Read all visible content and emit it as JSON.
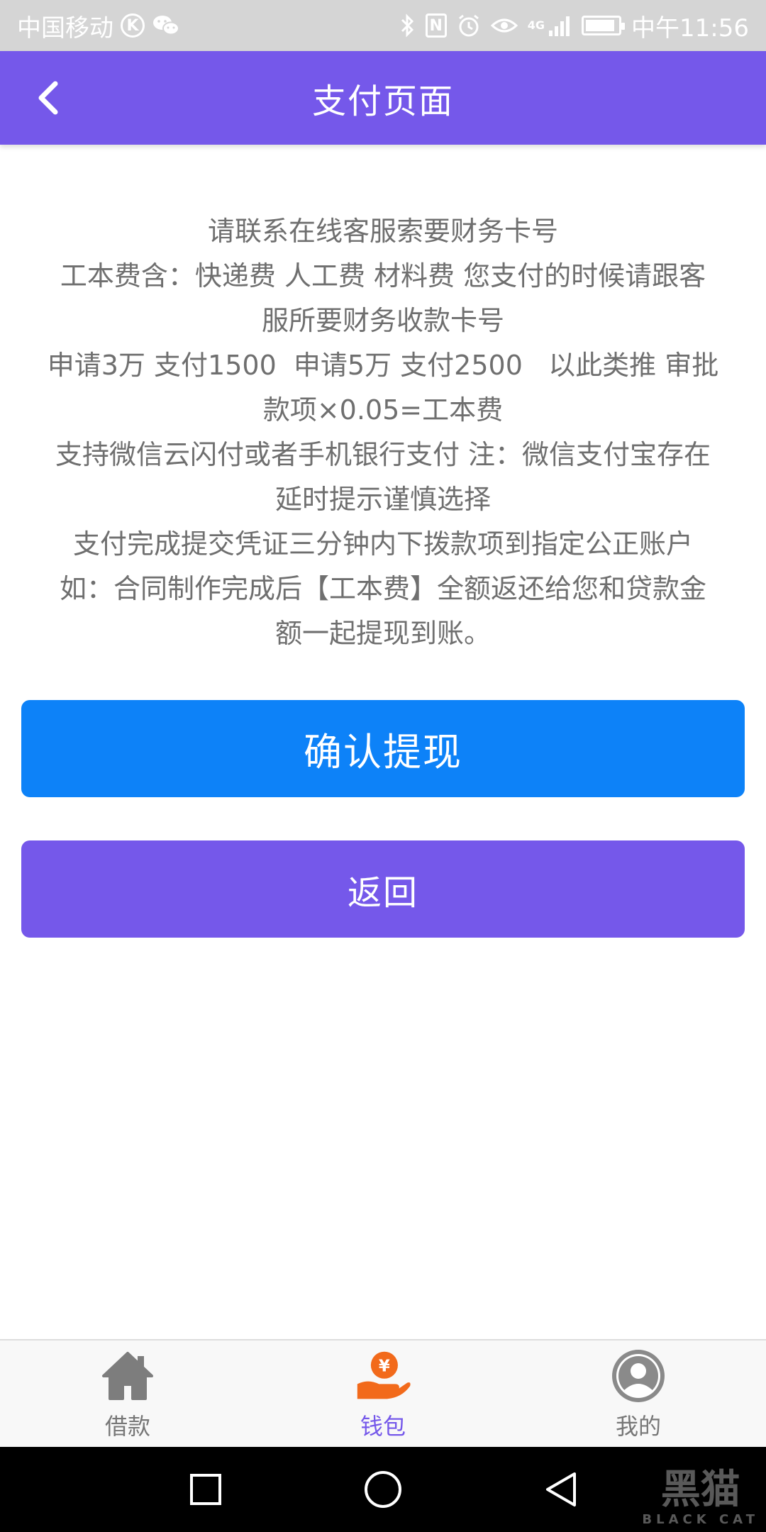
{
  "status_bar": {
    "carrier": "中国移动",
    "k_badge": "K",
    "nfc_badge": "N",
    "network": "4G",
    "time": "中午11:56"
  },
  "header": {
    "title": "支付页面",
    "back_icon": "chevron-left-icon"
  },
  "info": {
    "lines": [
      "请联系在线客服索要财务卡号",
      "工本费含：快递费 人工费 材料费 您支付的时候请跟客",
      "服所要财务收款卡号",
      "申请3万 支付1500  申请5万 支付2500   以此类推 审批",
      "款项×0.05=工本费",
      "支持微信云闪付或者手机银行支付 注：微信支付宝存在",
      "延时提示谨慎选择",
      "支付完成提交凭证三分钟内下拨款项到指定公正账户",
      "如：合同制作完成后【工本费】全额返还给您和贷款金",
      "额一起提现到账。"
    ]
  },
  "buttons": {
    "confirm_label": "确认提现",
    "back_label": "返回"
  },
  "tabs": [
    {
      "label": "借款",
      "icon": "home-icon",
      "active": false
    },
    {
      "label": "钱包",
      "icon": "wallet-icon",
      "active": true
    },
    {
      "label": "我的",
      "icon": "user-icon",
      "active": false
    }
  ],
  "watermark": {
    "text": "黑猫",
    "sub": "BLACK CAT"
  },
  "colors": {
    "accent": "#7558ea",
    "confirm": "#0d82f8",
    "text": "#6f6f6f",
    "tab_active": "#7558ea",
    "wallet_orange": "#f26a1b"
  }
}
